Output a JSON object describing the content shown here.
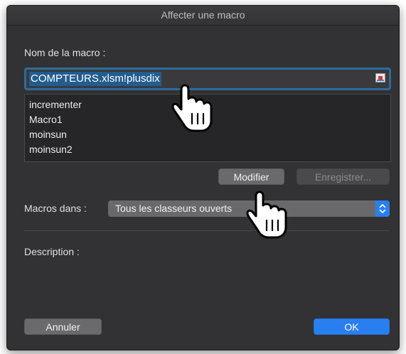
{
  "dialog": {
    "title": "Affecter une macro",
    "macro_name_label": "Nom de la macro :",
    "macro_name_value": "COMPTEURS.xlsm!plusdix",
    "macro_list": [
      {
        "label": "incrementer"
      },
      {
        "label": "Macro1"
      },
      {
        "label": "moinsun"
      },
      {
        "label": "moinsun2"
      }
    ],
    "modify_label": "Modifier",
    "record_label": "Enregistrer...",
    "macros_in_label": "Macros dans :",
    "macros_in_value": "Tous les classeurs ouverts",
    "description_label": "Description :",
    "cancel_label": "Annuler",
    "ok_label": "OK"
  },
  "colors": {
    "dialog_bg": "#323234",
    "accent": "#2a7ff0",
    "selection": "#235c8f"
  },
  "icons": [
    "range-reference-icon",
    "select-arrows-icon",
    "hand-pointer-icon"
  ]
}
